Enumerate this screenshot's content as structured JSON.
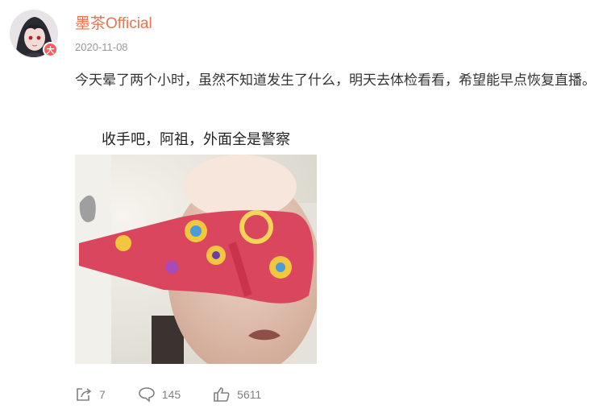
{
  "post": {
    "author": "墨茶Official",
    "verified_badge": "大",
    "date": "2020-11-08",
    "text": "今天晕了两个小时，虽然不知道发生了什么，明天去体检看看，希望能早点恢复直播。",
    "image_caption": "收手吧，阿祖，外面全是警察"
  },
  "actions": {
    "repost": {
      "icon": "share-icon",
      "count": "7"
    },
    "comment": {
      "icon": "comment-icon",
      "count": "145"
    },
    "like": {
      "icon": "thumbs-up-icon",
      "count": "5611"
    }
  },
  "colors": {
    "author": "#eb7350",
    "date": "#999999",
    "action_gray": "#808080",
    "badge": "#ff5a5f"
  }
}
